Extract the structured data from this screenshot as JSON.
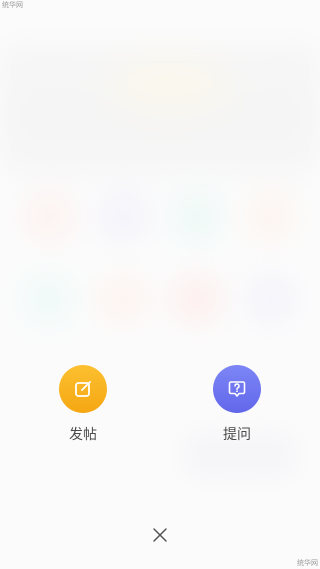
{
  "watermarks": {
    "top": "统华网",
    "bottom": "统华网"
  },
  "actions": [
    {
      "label": "发帖",
      "icon": "edit-icon",
      "color": "#f9b21d"
    },
    {
      "label": "提问",
      "icon": "question-bubble-icon",
      "color": "#6e74f0"
    }
  ],
  "close": {
    "icon": "close-icon"
  }
}
